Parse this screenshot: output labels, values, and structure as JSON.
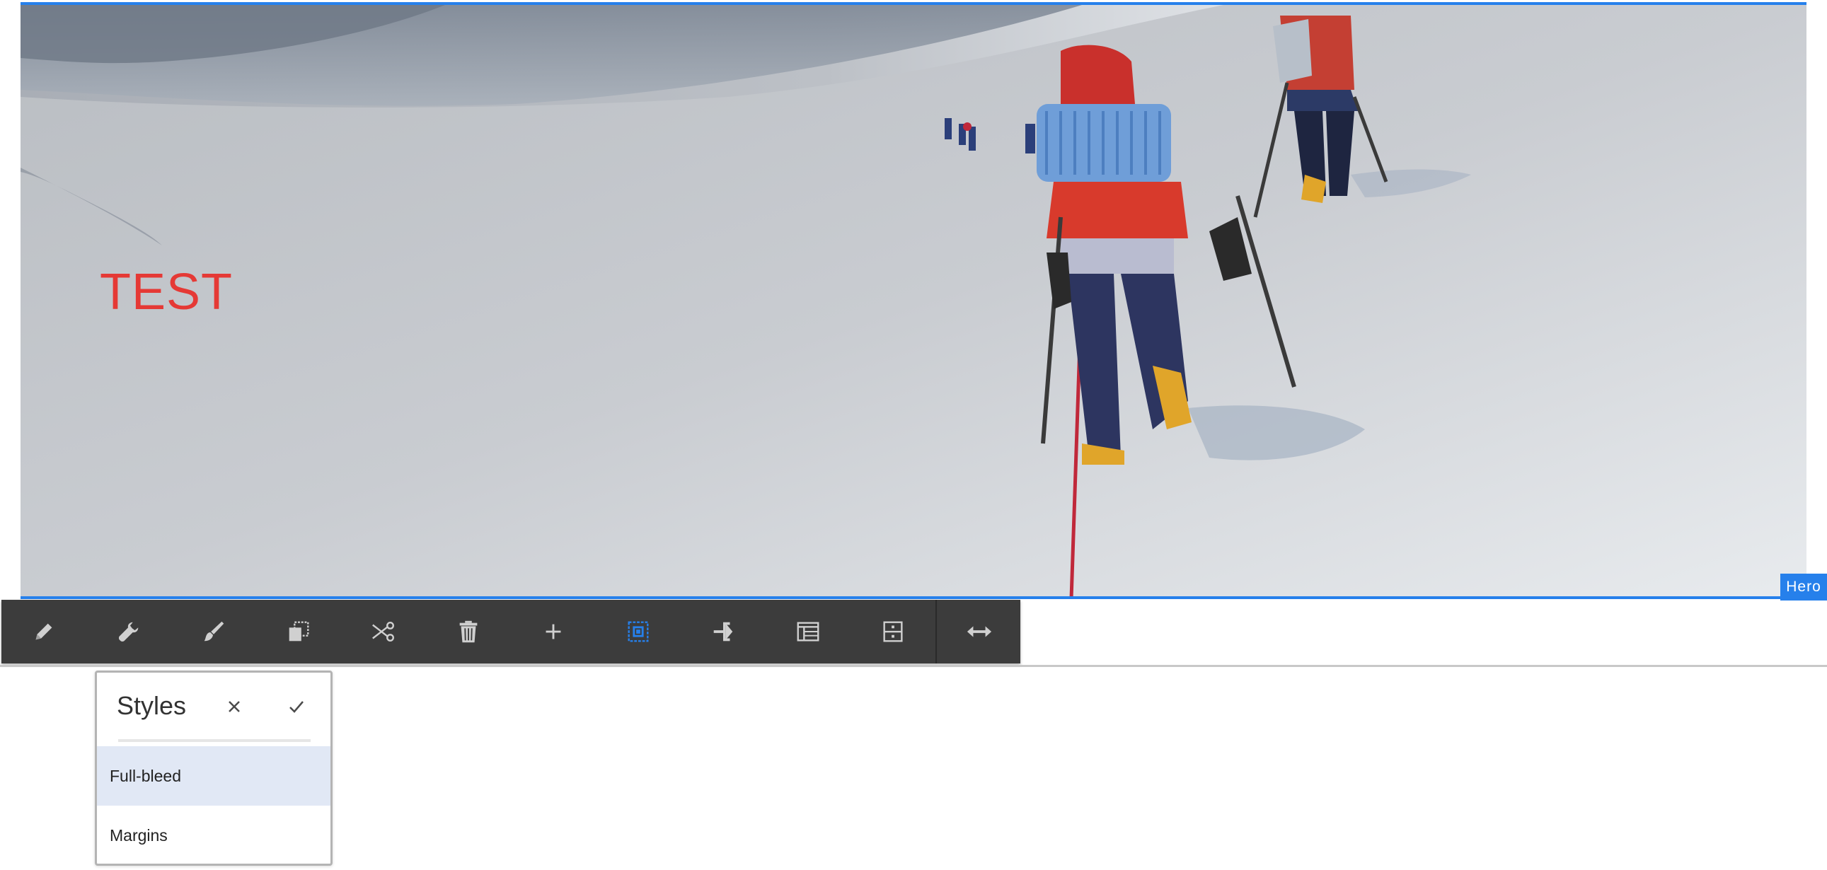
{
  "hero": {
    "text": "TEST",
    "badge": "Hero",
    "text_color": "#e53935",
    "frame_color": "#2680eb"
  },
  "toolbar": {
    "items": [
      {
        "name": "edit-button",
        "icon": "pencil-icon"
      },
      {
        "name": "configure-button",
        "icon": "wrench-icon"
      },
      {
        "name": "styles-button",
        "icon": "paintbrush-icon"
      },
      {
        "name": "copy-button",
        "icon": "copy-icon"
      },
      {
        "name": "cut-button",
        "icon": "scissors-icon"
      },
      {
        "name": "delete-button",
        "icon": "trash-icon"
      },
      {
        "name": "insert-button",
        "icon": "plus-icon"
      },
      {
        "name": "group-button",
        "icon": "select-group-icon",
        "active": true
      },
      {
        "name": "parent-button",
        "icon": "parent-icon"
      },
      {
        "name": "layout-button",
        "icon": "layout-icon"
      },
      {
        "name": "convert-button",
        "icon": "convert-icon"
      },
      {
        "name": "resize-button",
        "icon": "resize-icon"
      }
    ],
    "background": "#3c3c3c",
    "active_color": "#2680eb"
  },
  "styles_popover": {
    "title": "Styles",
    "options": [
      {
        "label": "Full-bleed",
        "selected": true
      },
      {
        "label": "Margins",
        "selected": false
      }
    ]
  }
}
